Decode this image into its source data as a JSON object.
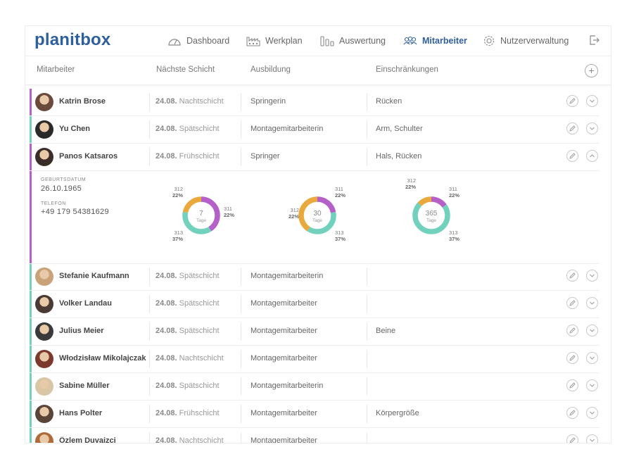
{
  "app": {
    "logo": "planitbox"
  },
  "nav": {
    "items": [
      {
        "label": "Dashboard",
        "icon": "gauge-icon"
      },
      {
        "label": "Werkplan",
        "icon": "factory-icon"
      },
      {
        "label": "Auswertung",
        "icon": "bar-chart-icon"
      },
      {
        "label": "Mitarbeiter",
        "icon": "users-icon",
        "active": true
      },
      {
        "label": "Nutzerverwaltung",
        "icon": "gear-icon"
      }
    ],
    "logout_icon": "logout-icon"
  },
  "table": {
    "headers": [
      "Mitarbeiter",
      "Nächste Schicht",
      "Ausbildung",
      "Einschränkungen"
    ],
    "add_icon": "plus-icon",
    "rows": [
      {
        "name": "Katrin Brose",
        "date": "24.08.",
        "shift": "Nachtschicht",
        "ausbildung": "Springerin",
        "einschraenkungen": "Rücken",
        "color": "#b55fc9"
      },
      {
        "name": "Yu Chen",
        "date": "24.08.",
        "shift": "Spätschicht",
        "ausbildung": "Montagemitarbeiterin",
        "einschraenkungen": "Arm, Schulter",
        "color": "#72d1bc"
      },
      {
        "name": "Panos Katsaros",
        "date": "24.08.",
        "shift": "Frühschicht",
        "ausbildung": "Springer",
        "einschraenkungen": "Hals, Rücken",
        "color": "#b55fc9"
      },
      {
        "name": "Stefanie Kaufmann",
        "date": "24.08.",
        "shift": "Spätschicht",
        "ausbildung": "Montagemitarbeiterin",
        "einschraenkungen": "",
        "color": "#72d1bc"
      },
      {
        "name": "Volker Landau",
        "date": "24.08.",
        "shift": "Spätschicht",
        "ausbildung": "Montagemitarbeiter",
        "einschraenkungen": "",
        "color": "#72d1bc"
      },
      {
        "name": "Julius Meier",
        "date": "24.08.",
        "shift": "Spätschicht",
        "ausbildung": "Montagemitarbeiter",
        "einschraenkungen": "Beine",
        "color": "#72d1bc"
      },
      {
        "name": "Włodzisław Mikolajczak",
        "date": "24.08.",
        "shift": "Nachtschicht",
        "ausbildung": "Montagemitarbeiter",
        "einschraenkungen": "",
        "color": "#72d1bc"
      },
      {
        "name": "Sabine Müller",
        "date": "24.08.",
        "shift": "Spätschicht",
        "ausbildung": "Montagemitarbeiterin",
        "einschraenkungen": "",
        "color": "#72d1bc"
      },
      {
        "name": "Hans Polter",
        "date": "24.08.",
        "shift": "Frühschicht",
        "ausbildung": "Montagemitarbeiter",
        "einschraenkungen": "Körpergröße",
        "color": "#72d1bc"
      },
      {
        "name": "Özlem Duvaizci",
        "date": "24.08.",
        "shift": "Nachtschicht",
        "ausbildung": "Montagemitarbeiter",
        "einschraenkungen": "",
        "color": "#72d1bc"
      }
    ]
  },
  "detail": {
    "birth_label": "GEBURTSDATUM",
    "birth_value": "26.10.1965",
    "phone_label": "TELEFON",
    "phone_value": "+49 179 54381629",
    "donuts": [
      {
        "center_value": "7",
        "center_unit": "Tage",
        "segments": [
          {
            "code": "311",
            "pct": "22%",
            "color": "#b55fc9",
            "share": 0.41
          },
          {
            "code": "313",
            "pct": "37%",
            "color": "#72d1bc",
            "share": 0.37
          },
          {
            "code": "312",
            "pct": "22%",
            "color": "#e9a93c",
            "share": 0.22
          }
        ]
      },
      {
        "center_value": "30",
        "center_unit": "Tage",
        "segments": [
          {
            "code": "311",
            "pct": "22%",
            "color": "#b55fc9",
            "share": 0.22
          },
          {
            "code": "313",
            "pct": "37%",
            "color": "#72d1bc",
            "share": 0.37
          },
          {
            "code": "312",
            "pct": "22%",
            "color": "#e9a93c",
            "share": 0.41
          }
        ]
      },
      {
        "center_value": "365",
        "center_unit": "Tage",
        "segments": [
          {
            "code": "311",
            "pct": "22%",
            "color": "#b55fc9",
            "share": 0.15
          },
          {
            "code": "313",
            "pct": "37%",
            "color": "#72d1bc",
            "share": 0.72
          },
          {
            "code": "312",
            "pct": "22%",
            "color": "#e9a93c",
            "share": 0.13
          }
        ]
      }
    ]
  }
}
